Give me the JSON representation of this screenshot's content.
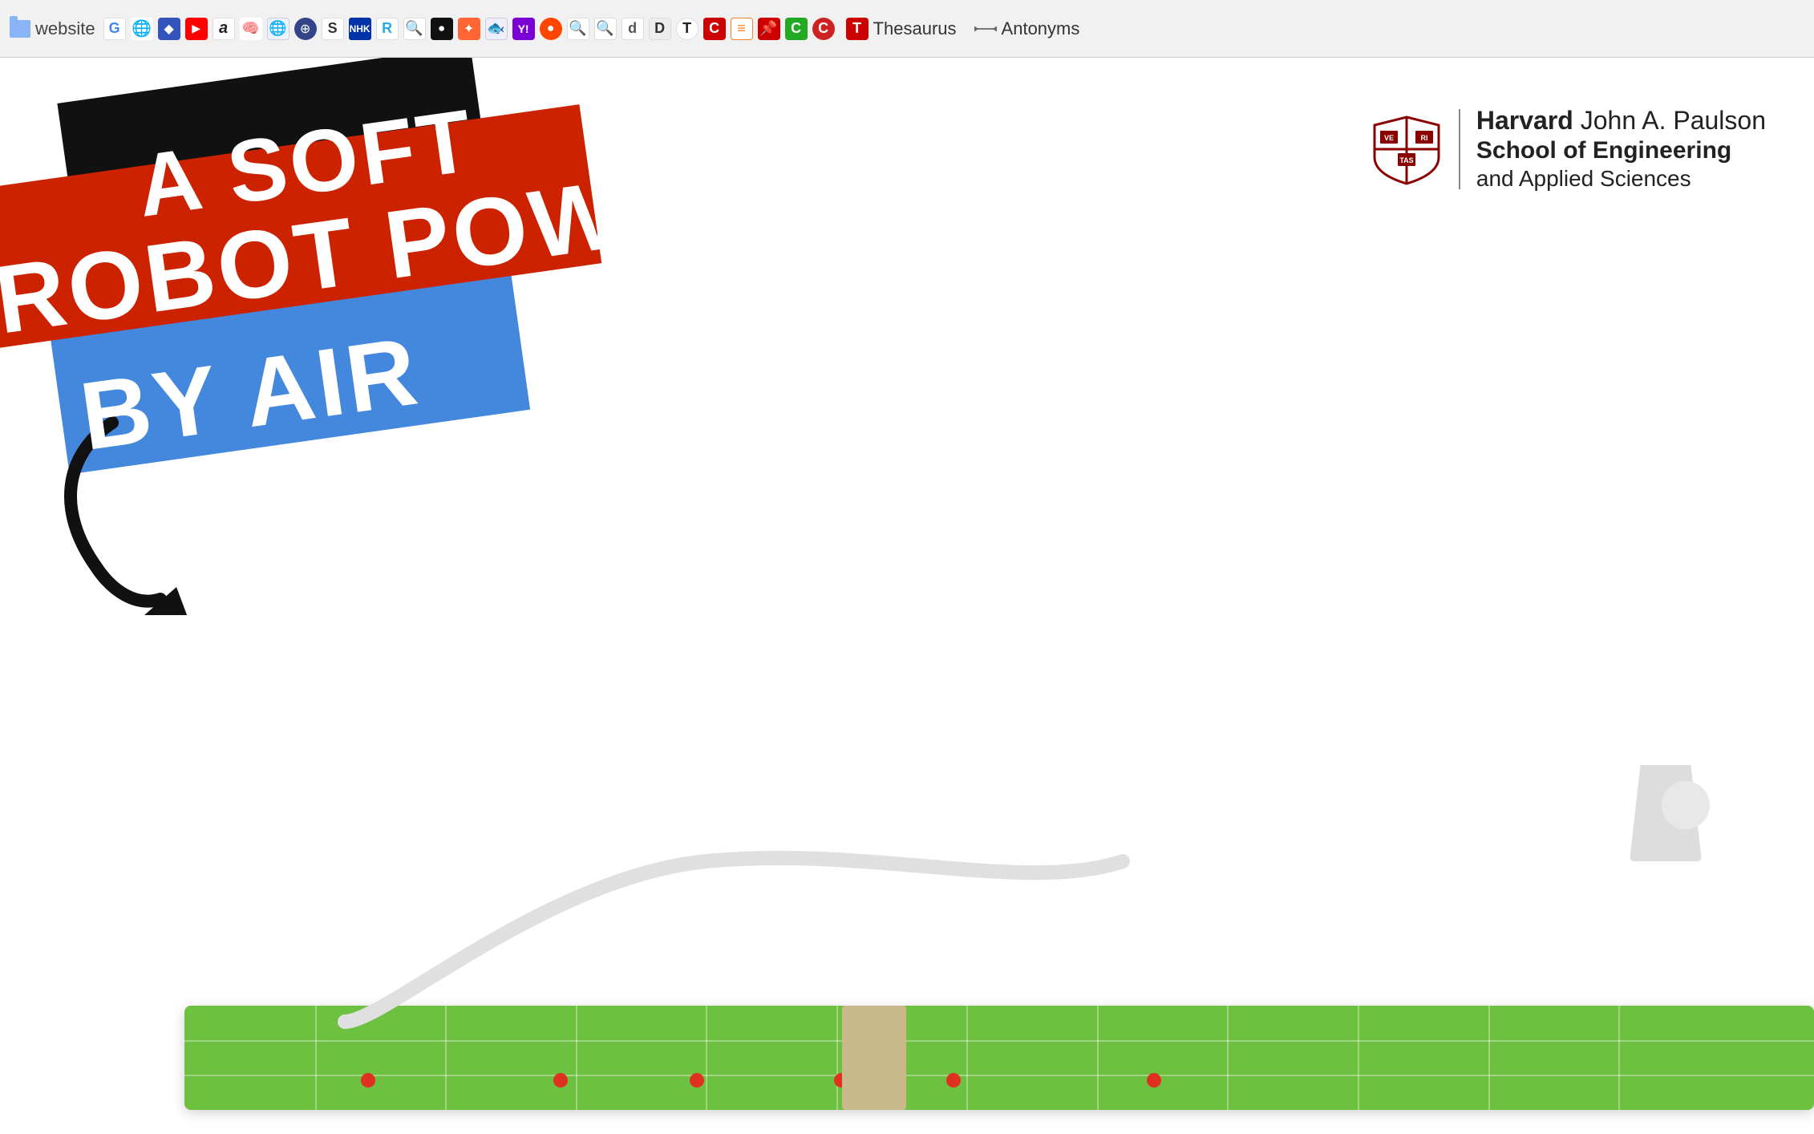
{
  "browser": {
    "folder_label": "website",
    "bookmarks": [
      {
        "id": "google",
        "label": "G",
        "color": "#4285f4",
        "text_color": "#fff"
      },
      {
        "id": "translate",
        "label": "🌐",
        "color": "#4285f4"
      },
      {
        "id": "diamond",
        "label": "◆",
        "color": "#4b7bec"
      },
      {
        "id": "youtube",
        "label": "▶",
        "color": "#ff0000"
      },
      {
        "id": "amazon",
        "label": "a",
        "color": "#ff9900"
      },
      {
        "id": "brain1",
        "label": "🧠",
        "color": "#888"
      },
      {
        "id": "globe",
        "label": "🌐",
        "color": "#4488cc"
      },
      {
        "id": "rings",
        "label": "⊕",
        "color": "#5566aa"
      },
      {
        "id": "s-icon",
        "label": "S",
        "color": "#333"
      },
      {
        "id": "nhk",
        "label": "NHK",
        "color": "#fff",
        "bg": "#cc0000"
      },
      {
        "id": "r-icon",
        "label": "R",
        "color": "#29aae2"
      },
      {
        "id": "search1",
        "label": "🔍",
        "color": "#4285f4"
      },
      {
        "id": "rec",
        "label": "⏺",
        "color": "#333"
      },
      {
        "id": "star",
        "label": "✦",
        "color": "#ff6633"
      },
      {
        "id": "logo1",
        "label": "🐟",
        "color": "#3366cc"
      },
      {
        "id": "yahoo",
        "label": "Y!",
        "color": "#6600cc"
      },
      {
        "id": "reddit",
        "label": "●",
        "color": "#ff4500"
      },
      {
        "id": "search2",
        "label": "🔍",
        "color": "#333"
      },
      {
        "id": "search3",
        "label": "🔍",
        "color": "#333"
      },
      {
        "id": "d-icon",
        "label": "d",
        "color": "#555"
      },
      {
        "id": "dict",
        "label": "D",
        "color": "#888"
      },
      {
        "id": "t-circle",
        "label": "T",
        "color": "#222"
      },
      {
        "id": "c1",
        "label": "C",
        "color": "#cc0000"
      },
      {
        "id": "stack",
        "label": "≡",
        "color": "#f48024"
      },
      {
        "id": "pin",
        "label": "📌",
        "color": "#cc2200"
      },
      {
        "id": "c2",
        "label": "C",
        "color": "#33cc33"
      },
      {
        "id": "c3",
        "label": "C",
        "color": "#cc2222"
      }
    ],
    "thesaurus": {
      "label": "Thesaurus",
      "icon_letter": "T",
      "icon_bg": "#c00"
    },
    "antonyms": {
      "label": "Antonyms",
      "icon": "⇔"
    }
  },
  "page": {
    "title_line1": "A SOFT",
    "title_line2": "ROBOT POWERED",
    "title_line3": "BY AIR"
  },
  "harvard": {
    "name": "Harvard",
    "john": "John A. Paulson",
    "school": "School of Engineering",
    "applied": "and Applied Sciences"
  }
}
